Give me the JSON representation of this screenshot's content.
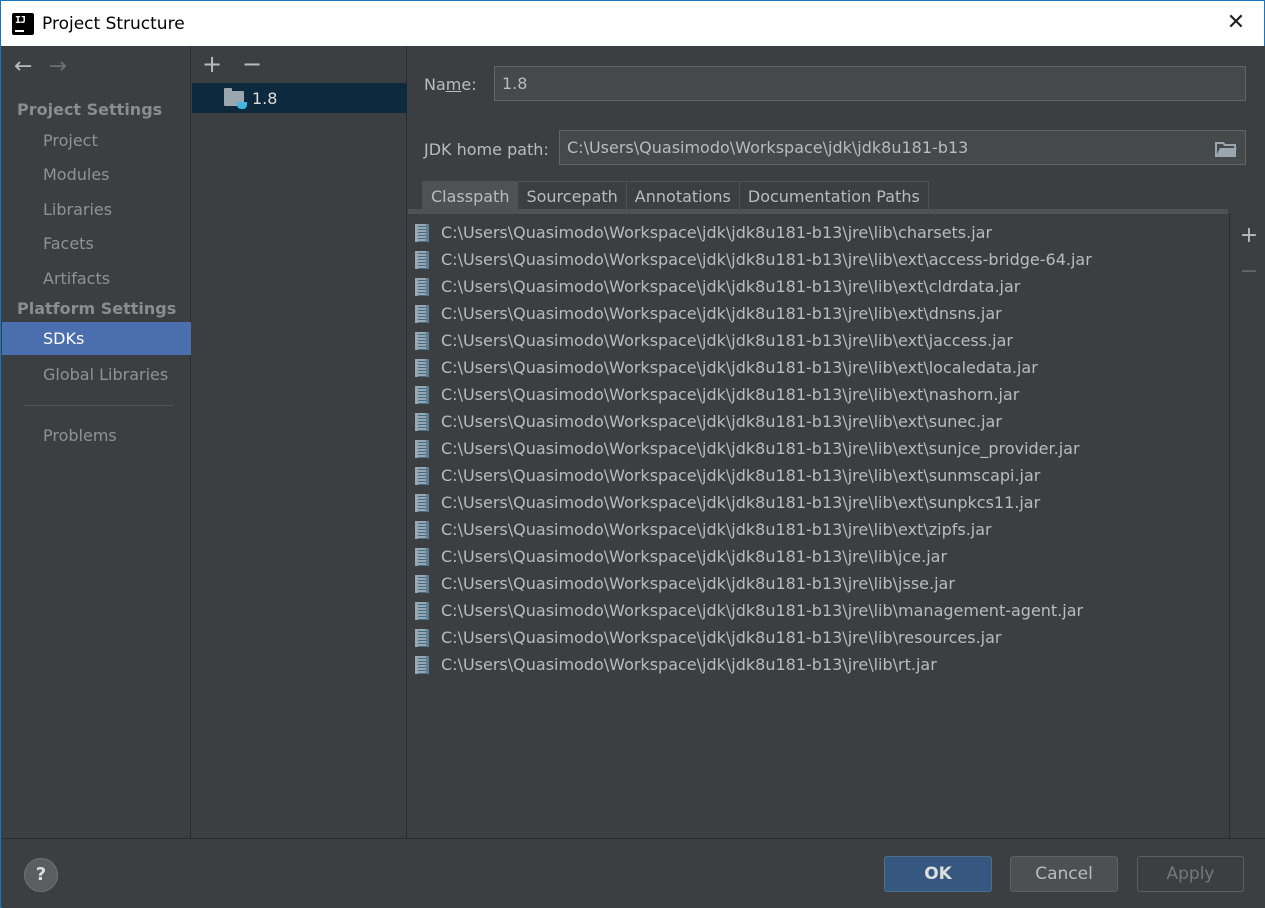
{
  "window": {
    "title": "Project Structure"
  },
  "nav": {
    "project_settings_title": "Project Settings",
    "project_items": [
      "Project",
      "Modules",
      "Libraries",
      "Facets",
      "Artifacts"
    ],
    "platform_settings_title": "Platform Settings",
    "platform_items": [
      "SDKs",
      "Global Libraries"
    ],
    "selected": "SDKs",
    "problems": "Problems"
  },
  "sdk_list": {
    "items": [
      {
        "name": "1.8",
        "icon": "jdk-folder-icon"
      }
    ],
    "selected": "1.8"
  },
  "detail": {
    "name_label_pre": "Na",
    "name_label_u": "m",
    "name_label_post": "e:",
    "name_value": "1.8",
    "jdk_home_label": "JDK home path:",
    "jdk_home_value": "C:\\Users\\Quasimodo\\Workspace\\jdk\\jdk8u181-b13",
    "tabs": [
      "Classpath",
      "Sourcepath",
      "Annotations",
      "Documentation Paths"
    ],
    "active_tab": "Classpath",
    "classpath": [
      "C:\\Users\\Quasimodo\\Workspace\\jdk\\jdk8u181-b13\\jre\\lib\\charsets.jar",
      "C:\\Users\\Quasimodo\\Workspace\\jdk\\jdk8u181-b13\\jre\\lib\\ext\\access-bridge-64.jar",
      "C:\\Users\\Quasimodo\\Workspace\\jdk\\jdk8u181-b13\\jre\\lib\\ext\\cldrdata.jar",
      "C:\\Users\\Quasimodo\\Workspace\\jdk\\jdk8u181-b13\\jre\\lib\\ext\\dnsns.jar",
      "C:\\Users\\Quasimodo\\Workspace\\jdk\\jdk8u181-b13\\jre\\lib\\ext\\jaccess.jar",
      "C:\\Users\\Quasimodo\\Workspace\\jdk\\jdk8u181-b13\\jre\\lib\\ext\\localedata.jar",
      "C:\\Users\\Quasimodo\\Workspace\\jdk\\jdk8u181-b13\\jre\\lib\\ext\\nashorn.jar",
      "C:\\Users\\Quasimodo\\Workspace\\jdk\\jdk8u181-b13\\jre\\lib\\ext\\sunec.jar",
      "C:\\Users\\Quasimodo\\Workspace\\jdk\\jdk8u181-b13\\jre\\lib\\ext\\sunjce_provider.jar",
      "C:\\Users\\Quasimodo\\Workspace\\jdk\\jdk8u181-b13\\jre\\lib\\ext\\sunmscapi.jar",
      "C:\\Users\\Quasimodo\\Workspace\\jdk\\jdk8u181-b13\\jre\\lib\\ext\\sunpkcs11.jar",
      "C:\\Users\\Quasimodo\\Workspace\\jdk\\jdk8u181-b13\\jre\\lib\\ext\\zipfs.jar",
      "C:\\Users\\Quasimodo\\Workspace\\jdk\\jdk8u181-b13\\jre\\lib\\jce.jar",
      "C:\\Users\\Quasimodo\\Workspace\\jdk\\jdk8u181-b13\\jre\\lib\\jsse.jar",
      "C:\\Users\\Quasimodo\\Workspace\\jdk\\jdk8u181-b13\\jre\\lib\\management-agent.jar",
      "C:\\Users\\Quasimodo\\Workspace\\jdk\\jdk8u181-b13\\jre\\lib\\resources.jar",
      "C:\\Users\\Quasimodo\\Workspace\\jdk\\jdk8u181-b13\\jre\\lib\\rt.jar"
    ]
  },
  "buttons": {
    "ok": "OK",
    "cancel": "Cancel",
    "apply": "Apply",
    "help": "?"
  },
  "icons": {
    "back": "back-arrow-icon",
    "forward": "forward-arrow-icon",
    "add": "plus-icon",
    "remove": "minus-icon",
    "browse": "folder-icon",
    "jar": "jar-archive-icon",
    "close": "close-icon"
  },
  "colors": {
    "selection": "#4b6eaf",
    "list_selection": "#0d293e",
    "ok_button": "#365880",
    "background": "#3c3f41"
  }
}
